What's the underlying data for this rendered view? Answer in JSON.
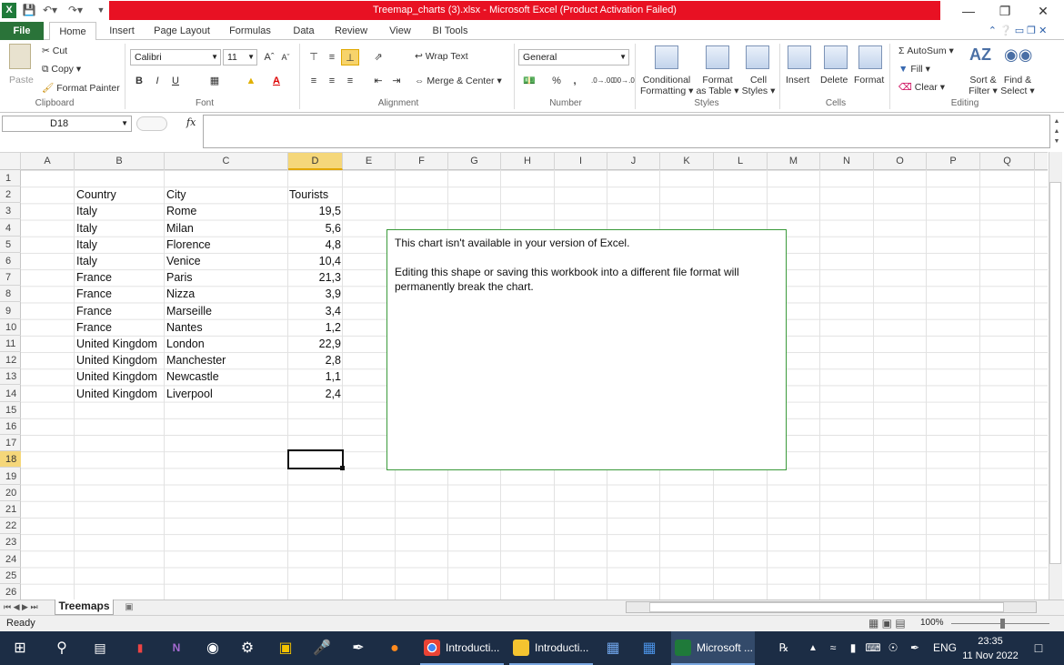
{
  "window": {
    "title": "Treemap_charts (3).xlsx - Microsoft Excel (Product Activation Failed)"
  },
  "tabs": [
    "File",
    "Home",
    "Insert",
    "Page Layout",
    "Formulas",
    "Data",
    "Review",
    "View",
    "BI Tools"
  ],
  "ribbon": {
    "clipboard": {
      "paste": "Paste",
      "cut": "Cut",
      "copy": "Copy",
      "format_painter": "Format Painter",
      "label": "Clipboard"
    },
    "font": {
      "name": "Calibri",
      "size": "11",
      "label": "Font"
    },
    "alignment": {
      "wrap_text": "Wrap Text",
      "merge_center": "Merge & Center",
      "label": "Alignment"
    },
    "number": {
      "format": "General",
      "label": "Number",
      "percent": "%",
      "comma": ","
    },
    "styles": {
      "conditional": "Conditional",
      "conditional2": "Formatting",
      "format_as": "Format",
      "format_as2": "as Table",
      "cell": "Cell",
      "cell2": "Styles",
      "label": "Styles"
    },
    "cells": {
      "insert": "Insert",
      "delete": "Delete",
      "format": "Format",
      "label": "Cells"
    },
    "editing": {
      "autosum": "AutoSum",
      "fill": "Fill",
      "clear": "Clear",
      "sort": "Sort &",
      "sort2": "Filter",
      "find": "Find &",
      "find2": "Select",
      "label": "Editing"
    }
  },
  "formula_bar": {
    "name_box": "D18",
    "fx": "fx",
    "content": ""
  },
  "columns": [
    "A",
    "B",
    "C",
    "D",
    "E",
    "F",
    "G",
    "H",
    "I",
    "J",
    "K",
    "L",
    "M",
    "N",
    "O",
    "P",
    "Q"
  ],
  "selected_column": "D",
  "rows": [
    "1",
    "2",
    "3",
    "4",
    "5",
    "6",
    "7",
    "8",
    "9",
    "10",
    "11",
    "12",
    "13",
    "14",
    "15",
    "16",
    "17",
    "18",
    "19",
    "20",
    "21",
    "22",
    "23",
    "24",
    "25",
    "26"
  ],
  "selected_row": "18",
  "table": {
    "headers": [
      "Country",
      "City",
      "Tourists"
    ],
    "data": [
      [
        "Italy",
        "Rome",
        "19,5"
      ],
      [
        "Italy",
        "Milan",
        "5,6"
      ],
      [
        "Italy",
        "Florence",
        "4,8"
      ],
      [
        "Italy",
        "Venice",
        "10,4"
      ],
      [
        "France",
        "Paris",
        "21,3"
      ],
      [
        "France",
        "Nizza",
        "3,9"
      ],
      [
        "France",
        "Marseille",
        "3,4"
      ],
      [
        "France",
        "Nantes",
        "1,2"
      ],
      [
        "United Kingdom",
        "London",
        "22,9"
      ],
      [
        "United Kingdom",
        "Manchester",
        "2,8"
      ],
      [
        "United Kingdom",
        "Newcastle",
        "1,1"
      ],
      [
        "United Kingdom",
        "Liverpool",
        "2,4"
      ]
    ]
  },
  "chart_placeholder": {
    "line1": "This chart isn't available in your version of Excel.",
    "line2": "Editing this shape or saving this workbook into a different file format will permanently break the chart."
  },
  "sheet_tab": "Treemaps",
  "status": {
    "ready": "Ready",
    "zoom": "100%"
  },
  "taskbar": {
    "apps": [
      "Introducti...",
      "Introducti...",
      "Microsoft ..."
    ],
    "lang": "ENG",
    "time": "23:35",
    "date": "11 Nov 2022"
  }
}
